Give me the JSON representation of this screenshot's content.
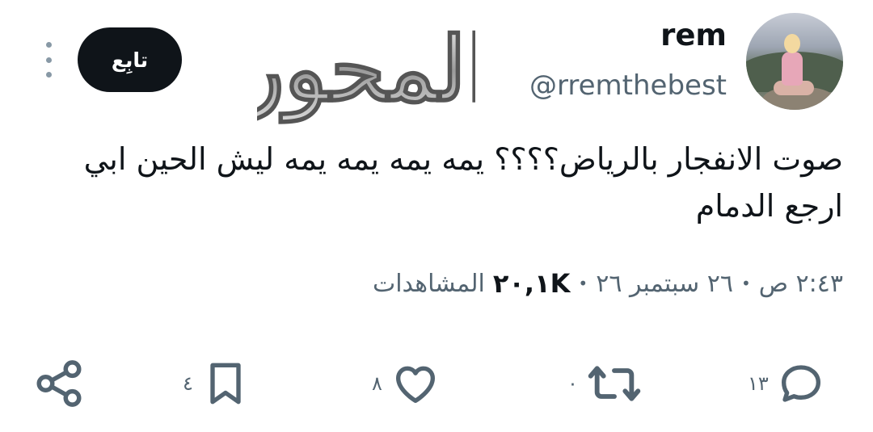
{
  "user": {
    "name": "rem",
    "handle": "@rremthebest"
  },
  "header": {
    "follow_label": "تابِع",
    "logo_text": "المحور"
  },
  "tweet": {
    "text": "صوت الانفجار بالرياض؟؟؟؟ يمه يمه يمه يمه ليش الحين ابي ارجع الدمام",
    "time": "٢:٤٣ ص",
    "date": "٢٦ سبتمبر ٢٦",
    "views_count": "٢٠,١K",
    "views_label": "المشاهدات",
    "separator": "•"
  },
  "actions": {
    "reply_count": "١٣",
    "retweet_count": "٠",
    "like_count": "٨",
    "bookmark_count": "٤"
  },
  "icons": [
    "more-icon",
    "reply-icon",
    "retweet-icon",
    "like-icon",
    "bookmark-icon",
    "share-icon"
  ]
}
